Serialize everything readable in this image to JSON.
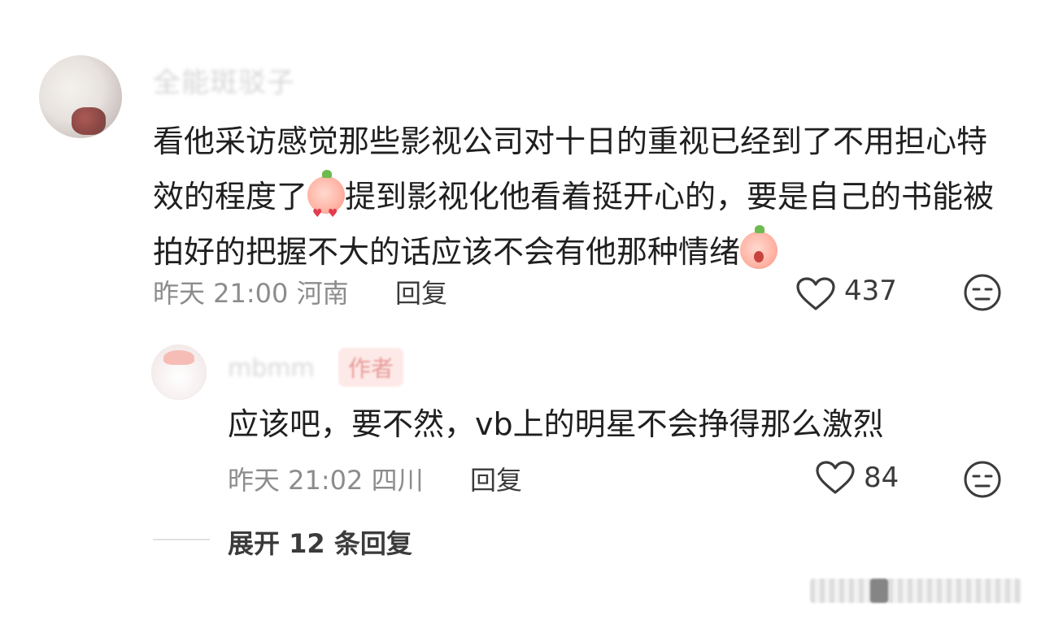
{
  "main_comment": {
    "username": "全能斑驳子",
    "text_part1": "看他采访感觉那些影视公司对十日的重视已经到了不用担心特效的程度了",
    "emoji1": "heart-eyes-emoji",
    "text_part2": "提到影视化他看着挺开心的，要是自己的书能被拍好的把握不大的话应该不会有他那种情绪",
    "emoji2": "shocked-emoji",
    "time": "昨天 21:00",
    "location": "河南",
    "reply_label": "回复",
    "like_count": "437"
  },
  "reply_comment": {
    "username": "mbmm",
    "author_badge": "作者",
    "text": "应该吧，要不然，vb上的明星不会挣得那么激烈",
    "time": "昨天 21:02",
    "location": "四川",
    "reply_label": "回复",
    "like_count": "84"
  },
  "expand": {
    "label": "展开 12 条回复"
  },
  "colors": {
    "text": "#1f1f1f",
    "meta": "#8c8c8c",
    "author_badge_bg": "#fde9e7",
    "author_badge_text": "#e69b99"
  }
}
